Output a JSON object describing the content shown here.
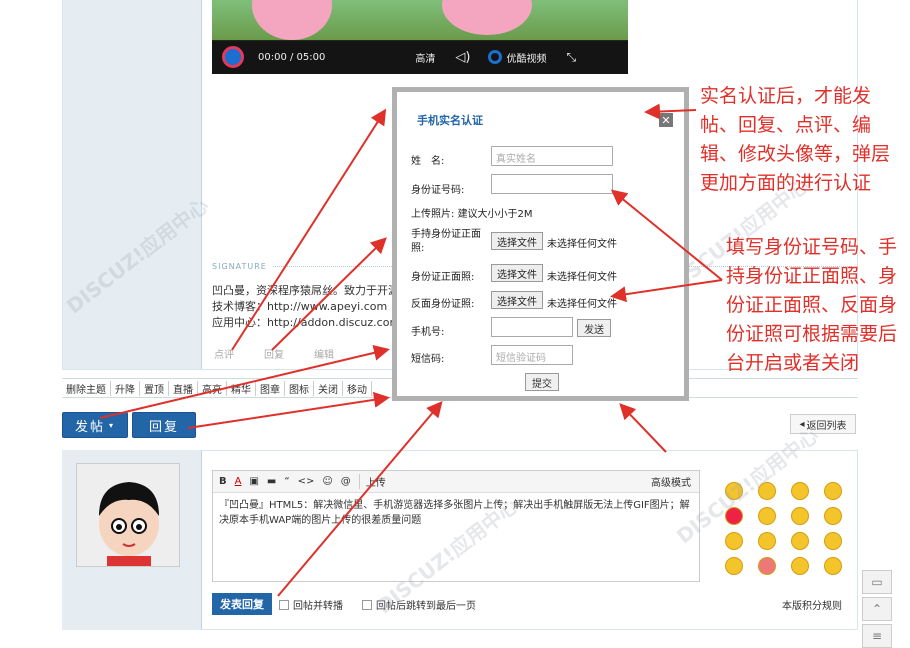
{
  "video": {
    "time": "00:00 / 05:00",
    "quality": "高清",
    "brand": "优酷视频"
  },
  "signature": {
    "title": "SIGNATURE",
    "line1": "凹凸曼，资深程序猿屌丝。致力于开源系统",
    "line2": "技术博客：http://www.apeyi.com",
    "line3": "应用中心：http://addon.discuz.com/?@ap"
  },
  "post_actions": [
    "点评",
    "回复",
    "编辑"
  ],
  "mod_bar": [
    "删除主题",
    "升降",
    "置顶",
    "直播",
    "高亮",
    "精华",
    "图章",
    "图标",
    "关闭",
    "移动"
  ],
  "buttons": {
    "post": "发帖",
    "reply": "回复",
    "back_list": "返回列表",
    "post_reply": "发表回复"
  },
  "editor": {
    "tools": [
      "B",
      "A",
      "上传",
      "高级模式"
    ],
    "text": "『凹凸曼』HTML5：解决微信里、手机游览器选择多张图片上传；解决出手机触屏版无法上传GIF图片；解决原本手机WAP端的图片上传的很差质量问题"
  },
  "options": {
    "reply_forward": "回帖并转播",
    "jump_last": "回帖后跳转到最后一页",
    "credits": "本版积分规则"
  },
  "modal": {
    "title": "手机实名认证",
    "close": "✕",
    "name_label": "姓　名:",
    "name_placeholder": "真实姓名",
    "id_label": "身份证号码:",
    "photo_label": "上传照片:",
    "photo_hint": "建议大小小于2M",
    "hold_label": "手持身份证正面照:",
    "front_label": "身份证正面照:",
    "back_label": "反面身份证照:",
    "file_button": "选择文件",
    "file_note": "未选择任何文件",
    "phone_label": "手机号:",
    "send_button": "发送",
    "code_label": "短信码:",
    "code_placeholder": "短信验证码",
    "submit_button": "提交"
  },
  "notes": {
    "note1": "实名认证后，才能发帖、回复、点评、编辑、修改头像等，弹层更加方面的进行认证",
    "note2": "填写身份证号码、手持身份证正面照、身份证正面照、反面身份证照可根据需要后台开启或者关闭"
  },
  "watermark": "DISCUZ!应用中心 addon.dismall.com",
  "colors": {
    "accent": "#2366a8",
    "note": "#e0302a"
  }
}
